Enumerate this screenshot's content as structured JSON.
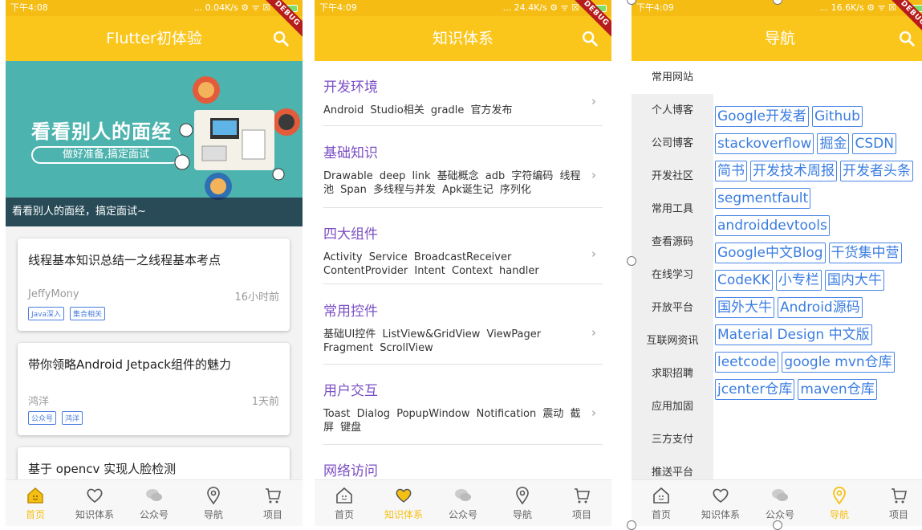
{
  "status_bars": [
    {
      "time": "下午4:08",
      "info": "... 0.04K/s ⚙ ᯤ ☒"
    },
    {
      "time": "下午4:09",
      "info": "... 24.4K/s ⚙ ᯤ ☒"
    },
    {
      "time": "下午4:09",
      "info": "... 16.6K/s ⚙ ᯤ ☒"
    }
  ],
  "debug_label": "DEBUG",
  "colors": {
    "appbar": "#fbc61c",
    "active_nav": "#f5c014",
    "category": "#7b4fc4",
    "chip": "#4a86e8"
  },
  "bottom_nav": [
    "首页",
    "知识体系",
    "公众号",
    "导航",
    "项目"
  ],
  "screen1": {
    "title": "Flutter初体验",
    "banner": {
      "headline": "看看别人的面经",
      "pill": "做好准备,搞定面试",
      "caption": "看看别人的面经，搞定面试~"
    },
    "articles": [
      {
        "title": "线程基本知识总结一之线程基本考点",
        "author": "JeffyMony",
        "time": "16小时前",
        "tags": [
          "Java深入",
          "集合相关"
        ]
      },
      {
        "title": "带你领略Android Jetpack组件的魅力",
        "author": "鸿洋",
        "time": "1天前",
        "tags": [
          "公众号",
          "鸿洋"
        ]
      },
      {
        "title": "基于 opencv 实现人脸检测",
        "author": "",
        "time": "",
        "tags": []
      }
    ]
  },
  "screen2": {
    "title": "知识体系",
    "sections": [
      {
        "title": "开发环境",
        "items": "Android Studio相关 gradle 官方发布"
      },
      {
        "title": "基础知识",
        "items": "Drawable deep link 基础概念 adb 字符编码 线程池 Span 多线程与并发 Apk诞生记 序列化"
      },
      {
        "title": "四大组件",
        "items": "Activity Service BroadcastReceiver ContentProvider Intent Context handler"
      },
      {
        "title": "常用控件",
        "items": "基础UI控件 ListView&GridView ViewPager Fragment ScrollView"
      },
      {
        "title": "用户交互",
        "items": "Toast Dialog PopupWindow Notification 震动 截屏 键盘"
      },
      {
        "title": "网络访问",
        "items": ""
      }
    ]
  },
  "screen3": {
    "title": "导航",
    "sidebar": [
      "常用网站",
      "个人博客",
      "公司博客",
      "开发社区",
      "常用工具",
      "查看源码",
      "在线学习",
      "开放平台",
      "互联网资讯",
      "求职招聘",
      "应用加固",
      "三方支付",
      "推送平台"
    ],
    "links": [
      "Google开发者",
      "Github",
      "stackoverflow",
      "掘金",
      "CSDN",
      "简书",
      "开发技术周报",
      "开发者头条",
      "segmentfault",
      "androiddevtools",
      "Google中文Blog",
      "干货集中营",
      "CodeKK",
      "小专栏",
      "国内大牛",
      "国外大牛",
      "Android源码",
      "Material Design 中文版",
      "leetcode",
      "google mvn仓库",
      "jcenter仓库",
      "maven仓库"
    ]
  }
}
